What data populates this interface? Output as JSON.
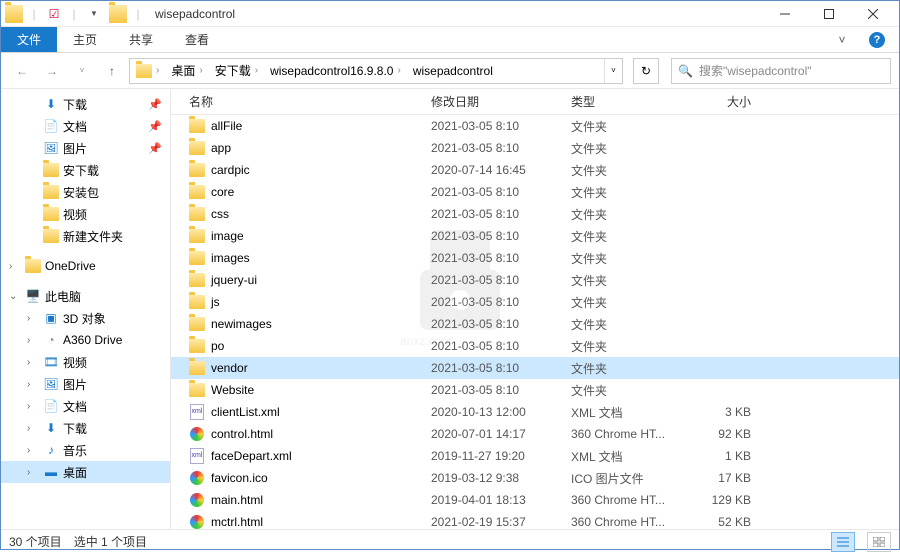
{
  "window": {
    "title": "wisepadcontrol"
  },
  "ribbon": {
    "file": "文件",
    "tabs": [
      "主页",
      "共享",
      "查看"
    ]
  },
  "breadcrumb": {
    "segments": [
      "桌面",
      "安下载",
      "wisepadcontrol16.9.8.0",
      "wisepadcontrol"
    ]
  },
  "search": {
    "placeholder": "搜索\"wisepadcontrol\""
  },
  "nav": {
    "quickaccess": [
      {
        "label": "下载",
        "icon": "download",
        "pinned": true
      },
      {
        "label": "文档",
        "icon": "document",
        "pinned": true
      },
      {
        "label": "图片",
        "icon": "picture",
        "pinned": true
      },
      {
        "label": "安下载",
        "icon": "folder",
        "pinned": false
      },
      {
        "label": "安装包",
        "icon": "folder",
        "pinned": false
      },
      {
        "label": "视频",
        "icon": "folder",
        "pinned": false
      },
      {
        "label": "新建文件夹",
        "icon": "folder",
        "pinned": false
      }
    ],
    "onedrive": "OneDrive",
    "thispc": "此电脑",
    "thispc_items": [
      {
        "label": "3D 对象",
        "icon": "3d"
      },
      {
        "label": "A360 Drive",
        "icon": "a360"
      },
      {
        "label": "视频",
        "icon": "video"
      },
      {
        "label": "图片",
        "icon": "picture"
      },
      {
        "label": "文档",
        "icon": "document"
      },
      {
        "label": "下载",
        "icon": "download"
      },
      {
        "label": "音乐",
        "icon": "music"
      },
      {
        "label": "桌面",
        "icon": "desktop",
        "selected": true
      }
    ]
  },
  "columns": {
    "name": "名称",
    "date": "修改日期",
    "type": "类型",
    "size": "大小"
  },
  "files": [
    {
      "name": "allFile",
      "date": "2021-03-05 8:10",
      "type": "文件夹",
      "size": "",
      "icon": "folder"
    },
    {
      "name": "app",
      "date": "2021-03-05 8:10",
      "type": "文件夹",
      "size": "",
      "icon": "folder"
    },
    {
      "name": "cardpic",
      "date": "2020-07-14 16:45",
      "type": "文件夹",
      "size": "",
      "icon": "folder"
    },
    {
      "name": "core",
      "date": "2021-03-05 8:10",
      "type": "文件夹",
      "size": "",
      "icon": "folder"
    },
    {
      "name": "css",
      "date": "2021-03-05 8:10",
      "type": "文件夹",
      "size": "",
      "icon": "folder"
    },
    {
      "name": "image",
      "date": "2021-03-05 8:10",
      "type": "文件夹",
      "size": "",
      "icon": "folder"
    },
    {
      "name": "images",
      "date": "2021-03-05 8:10",
      "type": "文件夹",
      "size": "",
      "icon": "folder"
    },
    {
      "name": "jquery-ui",
      "date": "2021-03-05 8:10",
      "type": "文件夹",
      "size": "",
      "icon": "folder"
    },
    {
      "name": "js",
      "date": "2021-03-05 8:10",
      "type": "文件夹",
      "size": "",
      "icon": "folder"
    },
    {
      "name": "newimages",
      "date": "2021-03-05 8:10",
      "type": "文件夹",
      "size": "",
      "icon": "folder"
    },
    {
      "name": "po",
      "date": "2021-03-05 8:10",
      "type": "文件夹",
      "size": "",
      "icon": "folder"
    },
    {
      "name": "vendor",
      "date": "2021-03-05 8:10",
      "type": "文件夹",
      "size": "",
      "icon": "folder",
      "selected": true
    },
    {
      "name": "Website",
      "date": "2021-03-05 8:10",
      "type": "文件夹",
      "size": "",
      "icon": "folder"
    },
    {
      "name": "clientList.xml",
      "date": "2020-10-13 12:00",
      "type": "XML 文档",
      "size": "3 KB",
      "icon": "xml"
    },
    {
      "name": "control.html",
      "date": "2020-07-01 14:17",
      "type": "360 Chrome HT...",
      "size": "92 KB",
      "icon": "html"
    },
    {
      "name": "faceDepart.xml",
      "date": "2019-11-27 19:20",
      "type": "XML 文档",
      "size": "1 KB",
      "icon": "xml"
    },
    {
      "name": "favicon.ico",
      "date": "2019-03-12 9:38",
      "type": "ICO 图片文件",
      "size": "17 KB",
      "icon": "ico"
    },
    {
      "name": "main.html",
      "date": "2019-04-01 18:13",
      "type": "360 Chrome HT...",
      "size": "129 KB",
      "icon": "html"
    },
    {
      "name": "mctrl.html",
      "date": "2021-02-19 15:37",
      "type": "360 Chrome HT...",
      "size": "52 KB",
      "icon": "html"
    }
  ],
  "status": {
    "count": "30 个项目",
    "selected": "选中 1 个项目"
  }
}
